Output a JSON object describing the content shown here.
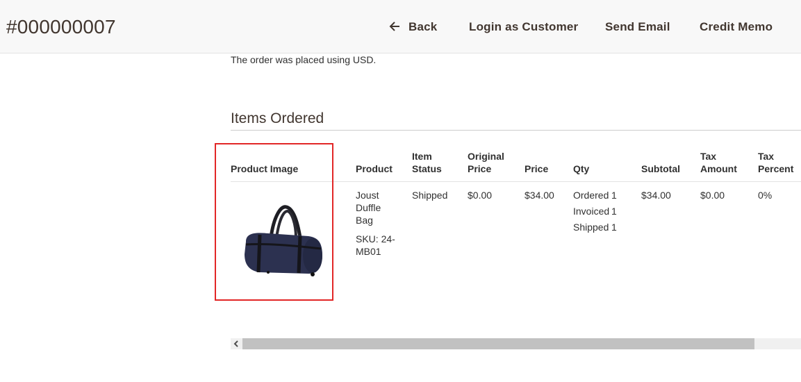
{
  "header": {
    "order_number": "#000000007",
    "actions": {
      "back": "Back",
      "login_as_customer": "Login as Customer",
      "send_email": "Send Email",
      "credit_memo": "Credit Memo"
    }
  },
  "currency_note": "The order was placed using USD.",
  "items_section": {
    "title": "Items Ordered",
    "columns": {
      "product_image": "Product Image",
      "product": "Product",
      "item_status_1": "Item",
      "item_status_2": "Status",
      "original_price_1": "Original",
      "original_price_2": "Price",
      "price": "Price",
      "qty": "Qty",
      "subtotal": "Subtotal",
      "tax_amount_1": "Tax",
      "tax_amount_2": "Amount",
      "tax_percent_1": "Tax",
      "tax_percent_2": "Percent"
    },
    "row": {
      "product_name_1": "Joust",
      "product_name_2": "Duffle",
      "product_name_3": "Bag",
      "sku_1": "SKU: 24-",
      "sku_2": "MB01",
      "item_status": "Shipped",
      "original_price": "$0.00",
      "price": "$34.00",
      "qty_ordered_label": "Ordered",
      "qty_ordered": "1",
      "qty_invoiced_label": "Invoiced",
      "qty_invoiced": "1",
      "qty_shipped_label": "Shipped",
      "qty_shipped": "1",
      "subtotal": "$34.00",
      "tax_amount": "$0.00",
      "tax_percent": "0%"
    }
  },
  "colors": {
    "highlight": "#e22626",
    "header_bg": "#f8f8f8",
    "text": "#303030"
  },
  "icons": {
    "back": "arrow-left-icon",
    "scroll_left": "chevron-left-icon"
  }
}
